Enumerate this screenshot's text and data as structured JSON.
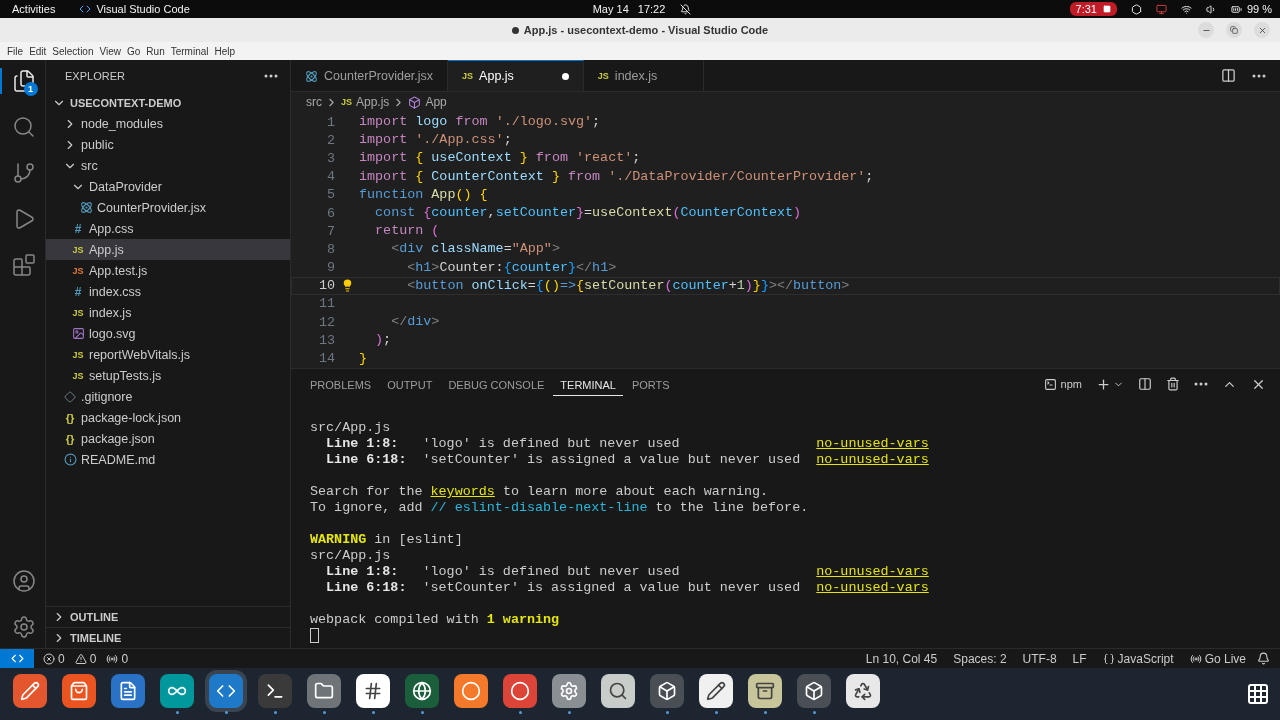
{
  "top_bar": {
    "activities": "Activities",
    "app_name": "Visual Studio Code",
    "date": "May 14",
    "time": "17:22",
    "recording": "7:31",
    "battery": "99 %"
  },
  "title_bar": {
    "modified": true,
    "title": "App.js - usecontext-demo - Visual Studio Code"
  },
  "menu": [
    "File",
    "Edit",
    "Selection",
    "View",
    "Go",
    "Run",
    "Terminal",
    "Help"
  ],
  "activity_bar": {
    "items": [
      {
        "selected": true,
        "badge": "1"
      },
      {
        "selected": false
      },
      {
        "selected": false
      },
      {
        "selected": false
      },
      {
        "selected": false
      }
    ]
  },
  "explorer": {
    "title": "EXPLORER",
    "project": {
      "label": "USECONTEXT-DEMO",
      "expanded": true
    },
    "tree": [
      {
        "label": "node_modules",
        "kind": "folder",
        "expanded": false,
        "selected": false
      },
      {
        "label": "public",
        "kind": "folder",
        "expanded": false,
        "selected": false
      },
      {
        "label": "src",
        "kind": "folder",
        "expanded": true,
        "selected": false,
        "children": [
          {
            "label": "DataProvider",
            "kind": "folder",
            "expanded": true,
            "selected": false,
            "children": [
              {
                "label": "CounterProvider.jsx",
                "kind": "react",
                "selected": false
              }
            ]
          },
          {
            "label": "App.css",
            "kind": "css",
            "glyph": "#",
            "selected": false
          },
          {
            "label": "App.js",
            "kind": "js",
            "glyph": "JS",
            "selected": true
          },
          {
            "label": "App.test.js",
            "kind": "test",
            "glyph": "JS",
            "selected": false
          },
          {
            "label": "index.css",
            "kind": "css",
            "glyph": "#",
            "selected": false
          },
          {
            "label": "index.js",
            "kind": "js",
            "glyph": "JS",
            "selected": false
          },
          {
            "label": "logo.svg",
            "kind": "svg",
            "selected": false
          },
          {
            "label": "reportWebVitals.js",
            "kind": "js",
            "glyph": "JS",
            "selected": false
          },
          {
            "label": "setupTests.js",
            "kind": "js",
            "glyph": "JS",
            "selected": false
          }
        ]
      },
      {
        "label": ".gitignore",
        "kind": "git",
        "selected": false
      },
      {
        "label": "package-lock.json",
        "kind": "json",
        "glyph": "{}",
        "selected": false
      },
      {
        "label": "package.json",
        "kind": "json",
        "glyph": "{}",
        "selected": false
      },
      {
        "label": "README.md",
        "kind": "info",
        "selected": false
      }
    ],
    "sections": [
      {
        "label": "OUTLINE",
        "expanded": false
      },
      {
        "label": "TIMELINE",
        "expanded": false
      }
    ]
  },
  "editor": {
    "tabs": [
      {
        "label": "CounterProvider.jsx",
        "kind": "react",
        "selected": false,
        "modified": false
      },
      {
        "label": "App.js",
        "kind": "js",
        "glyph": "JS",
        "selected": true,
        "modified": true
      },
      {
        "label": "index.js",
        "kind": "js",
        "glyph": "JS",
        "selected": false,
        "modified": false
      }
    ],
    "breadcrumbs": [
      {
        "label": "src",
        "kind": "folder"
      },
      {
        "label": "App.js",
        "kind": "js",
        "glyph": "JS"
      },
      {
        "label": "App",
        "kind": "symbol"
      }
    ],
    "lines": [
      {
        "number": "1",
        "active": false,
        "tokens": [
          {
            "text": "import",
            "kind": "kw"
          },
          {
            "text": " logo ",
            "kind": "var"
          },
          {
            "text": "from",
            "kind": "kw"
          },
          {
            "text": " './logo.svg'",
            "kind": "str"
          },
          {
            "text": ";",
            "kind": "p"
          }
        ]
      },
      {
        "number": "2",
        "active": false,
        "tokens": [
          {
            "text": "import",
            "kind": "kw"
          },
          {
            "text": " './App.css'",
            "kind": "str"
          },
          {
            "text": ";",
            "kind": "p"
          }
        ]
      },
      {
        "number": "3",
        "active": false,
        "tokens": [
          {
            "text": "import",
            "kind": "kw"
          },
          {
            "text": " {",
            "kind": "b1"
          },
          {
            "text": " useContext ",
            "kind": "var"
          },
          {
            "text": "}",
            "kind": "b1"
          },
          {
            "text": " from",
            "kind": "kw"
          },
          {
            "text": " 'react'",
            "kind": "str"
          },
          {
            "text": ";",
            "kind": "p"
          }
        ]
      },
      {
        "number": "4",
        "active": false,
        "tokens": [
          {
            "text": "import",
            "kind": "kw"
          },
          {
            "text": " {",
            "kind": "b1"
          },
          {
            "text": " CounterContext ",
            "kind": "var"
          },
          {
            "text": "}",
            "kind": "b1"
          },
          {
            "text": " from",
            "kind": "kw"
          },
          {
            "text": " './DataProvider/CounterProvider'",
            "kind": "str"
          },
          {
            "text": ";",
            "kind": "p"
          }
        ]
      },
      {
        "number": "5",
        "active": false,
        "tokens": [
          {
            "text": "function",
            "kind": "decl"
          },
          {
            "text": " App",
            "kind": "fn"
          },
          {
            "text": "()",
            "kind": "b1"
          },
          {
            "text": " {",
            "kind": "b1"
          }
        ]
      },
      {
        "number": "6",
        "active": false,
        "tokens": [
          {
            "text": "  const",
            "kind": "decl"
          },
          {
            "text": " {",
            "kind": "b2"
          },
          {
            "text": "counter",
            "kind": "const"
          },
          {
            "text": ",",
            "kind": "p"
          },
          {
            "text": "setCounter",
            "kind": "const"
          },
          {
            "text": "}",
            "kind": "b2"
          },
          {
            "text": "=",
            "kind": "p"
          },
          {
            "text": "useContext",
            "kind": "fn"
          },
          {
            "text": "(",
            "kind": "b2"
          },
          {
            "text": "CounterContext",
            "kind": "const"
          },
          {
            "text": ")",
            "kind": "b2"
          }
        ]
      },
      {
        "number": "7",
        "active": false,
        "tokens": [
          {
            "text": "  return",
            "kind": "kw"
          },
          {
            "text": " (",
            "kind": "b2"
          }
        ]
      },
      {
        "number": "8",
        "active": false,
        "tokens": [
          {
            "text": "    <",
            "kind": "tag"
          },
          {
            "text": "div",
            "kind": "tagname"
          },
          {
            "text": " className",
            "kind": "attr"
          },
          {
            "text": "=",
            "kind": "p"
          },
          {
            "text": "\"App\"",
            "kind": "str"
          },
          {
            "text": ">",
            "kind": "tag"
          }
        ]
      },
      {
        "number": "9",
        "active": false,
        "tokens": [
          {
            "text": "      <",
            "kind": "tag"
          },
          {
            "text": "h1",
            "kind": "tagname"
          },
          {
            "text": ">",
            "kind": "tag"
          },
          {
            "text": "Counter:",
            "kind": "p"
          },
          {
            "text": "{",
            "kind": "b3"
          },
          {
            "text": "counter",
            "kind": "const"
          },
          {
            "text": "}",
            "kind": "b3"
          },
          {
            "text": "</",
            "kind": "tag"
          },
          {
            "text": "h1",
            "kind": "tagname"
          },
          {
            "text": ">",
            "kind": "tag"
          }
        ]
      },
      {
        "number": "10",
        "active": true,
        "tokens": [
          {
            "text": "      <",
            "kind": "tag"
          },
          {
            "text": "button",
            "kind": "tagname"
          },
          {
            "text": " onClick",
            "kind": "attr"
          },
          {
            "text": "=",
            "kind": "p"
          },
          {
            "text": "{",
            "kind": "b3"
          },
          {
            "text": "()",
            "kind": "b1"
          },
          {
            "text": "=>",
            "kind": "decl"
          },
          {
            "text": "{",
            "kind": "b1"
          },
          {
            "text": "setCounter",
            "kind": "fn"
          },
          {
            "text": "(",
            "kind": "b2"
          },
          {
            "text": "counter",
            "kind": "const"
          },
          {
            "text": "+",
            "kind": "p"
          },
          {
            "text": "1",
            "kind": "num"
          },
          {
            "text": ")",
            "kind": "b2"
          },
          {
            "text": "}",
            "kind": "b1"
          },
          {
            "text": "}",
            "kind": "b3"
          },
          {
            "text": "></",
            "kind": "tag"
          },
          {
            "text": "button",
            "kind": "tagname"
          },
          {
            "text": ">",
            "kind": "tag"
          }
        ]
      },
      {
        "number": "11",
        "active": false
      },
      {
        "number": "12",
        "active": false,
        "tokens": [
          {
            "text": "    </",
            "kind": "tag"
          },
          {
            "text": "div",
            "kind": "tagname"
          },
          {
            "text": ">",
            "kind": "tag"
          }
        ]
      },
      {
        "number": "13",
        "active": false,
        "tokens": [
          {
            "text": "  )",
            "kind": "b2"
          },
          {
            "text": ";",
            "kind": "p"
          }
        ]
      },
      {
        "number": "14",
        "active": false,
        "tokens": [
          {
            "text": "}",
            "kind": "b1"
          }
        ]
      }
    ]
  },
  "panel": {
    "tabs": [
      {
        "label": "PROBLEMS",
        "selected": false
      },
      {
        "label": "OUTPUT",
        "selected": false
      },
      {
        "label": "DEBUG CONSOLE",
        "selected": false
      },
      {
        "label": "TERMINAL",
        "selected": true
      },
      {
        "label": "PORTS",
        "selected": false
      }
    ],
    "shell": "npm",
    "terminal": [
      {
        "gap_before": false,
        "tokens": [
          {
            "text": "src/App.js",
            "kind": "p"
          }
        ]
      },
      {
        "gap_before": false,
        "tokens": [
          {
            "text": "  Line 1:8:",
            "kind": "b"
          },
          {
            "text": "   'logo' is defined but never used                 ",
            "kind": "p"
          },
          {
            "text": "no-unused-vars",
            "kind": "link"
          }
        ]
      },
      {
        "gap_before": false,
        "tokens": [
          {
            "text": "  Line 6:18:",
            "kind": "b"
          },
          {
            "text": "  'setCounter' is assigned a value but never used  ",
            "kind": "p"
          },
          {
            "text": "no-unused-vars",
            "kind": "link"
          }
        ]
      },
      {
        "gap_before": true,
        "tokens": [
          {
            "text": "Search for the ",
            "kind": "p"
          },
          {
            "text": "keywords",
            "kind": "link"
          },
          {
            "text": " to learn more about each warning.",
            "kind": "p"
          }
        ]
      },
      {
        "gap_before": false,
        "tokens": [
          {
            "text": "To ignore, add ",
            "kind": "p"
          },
          {
            "text": "// eslint-disable-next-line",
            "kind": "cyan"
          },
          {
            "text": " to the line before.",
            "kind": "p"
          }
        ]
      },
      {
        "gap_before": true,
        "tokens": [
          {
            "text": "WARNING",
            "kind": "warn"
          },
          {
            "text": " in [eslint]",
            "kind": "p"
          }
        ]
      },
      {
        "gap_before": false,
        "tokens": [
          {
            "text": "src/App.js",
            "kind": "p"
          }
        ]
      },
      {
        "gap_before": false,
        "tokens": [
          {
            "text": "  Line 1:8:",
            "kind": "b"
          },
          {
            "text": "   'logo' is defined but never used                 ",
            "kind": "p"
          },
          {
            "text": "no-unused-vars",
            "kind": "link"
          }
        ]
      },
      {
        "gap_before": false,
        "tokens": [
          {
            "text": "  Line 6:18:",
            "kind": "b"
          },
          {
            "text": "  'setCounter' is assigned a value but never used  ",
            "kind": "p"
          },
          {
            "text": "no-unused-vars",
            "kind": "link"
          }
        ]
      },
      {
        "gap_before": true,
        "tokens": [
          {
            "text": "webpack compiled with ",
            "kind": "p"
          },
          {
            "text": "1 warning",
            "kind": "warn"
          }
        ]
      },
      {
        "cursor": true
      }
    ]
  },
  "status_bar": {
    "errors": "0",
    "warnings": "0",
    "ports": "0",
    "items": [
      "Ln 10, Col 45",
      "Spaces: 2",
      "UTF-8",
      "LF"
    ],
    "language": "JavaScript",
    "go_live": "Go Live"
  },
  "dock": [
    {
      "running": false,
      "selected": false
    },
    {
      "running": false,
      "selected": false
    },
    {
      "running": false,
      "selected": false
    },
    {
      "running": true,
      "selected": false
    },
    {
      "running": true,
      "selected": true
    },
    {
      "running": true,
      "selected": false
    },
    {
      "running": true,
      "selected": false
    },
    {
      "running": true,
      "selected": false
    },
    {
      "running": true,
      "selected": false
    },
    {
      "running": false,
      "selected": false
    },
    {
      "running": true,
      "selected": false
    },
    {
      "running": true,
      "selected": false
    },
    {
      "running": false,
      "selected": false
    },
    {
      "running": true,
      "selected": false
    },
    {
      "running": true,
      "selected": false
    },
    {
      "running": true,
      "selected": false
    },
    {
      "running": true,
      "selected": false
    },
    {
      "running": false,
      "selected": false
    }
  ]
}
